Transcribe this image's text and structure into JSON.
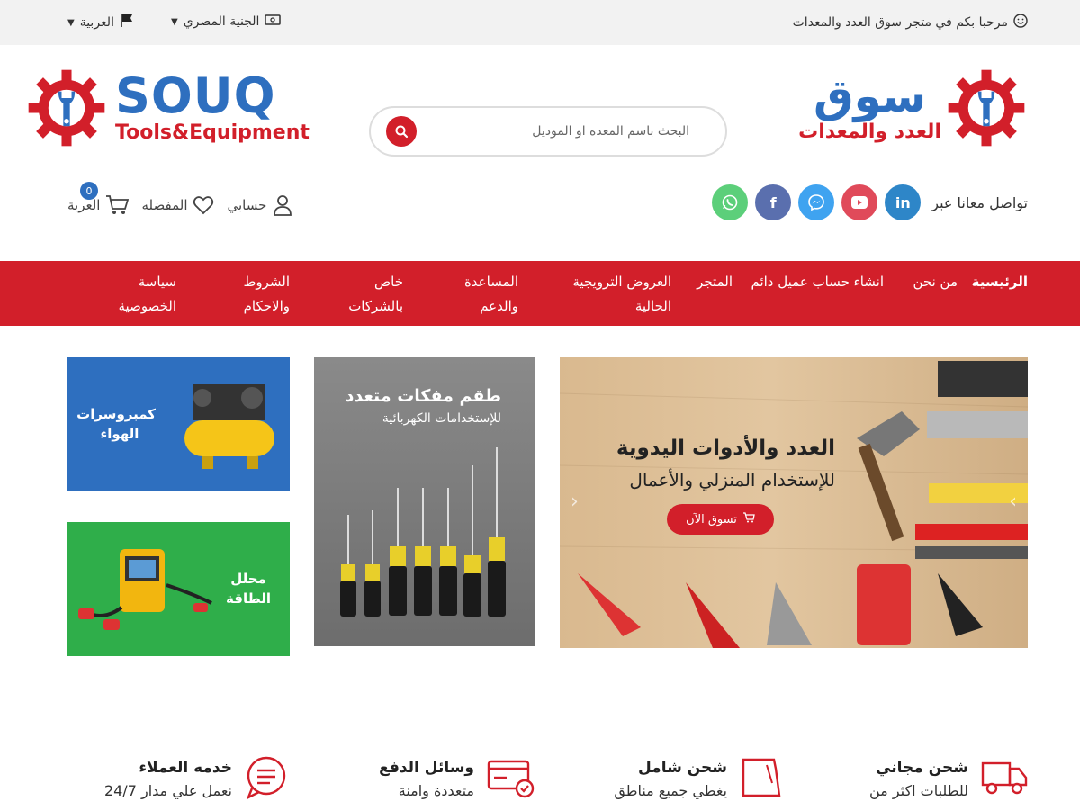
{
  "topbar": {
    "welcome": "مرحبا بكم في متجر سوق العدد والمعدات",
    "currency": "الجنية المصري",
    "language": "العربية"
  },
  "logo": {
    "ar_big": "سوق",
    "ar_small": "العدد والمعدات",
    "en_big": "SOUQ",
    "en_small": "Tools&Equipment"
  },
  "search": {
    "placeholder": "البحث باسم المعده او الموديل"
  },
  "social": {
    "label": "تواصل معانا عبر",
    "items": [
      "linkedin-icon",
      "youtube-icon",
      "messenger-icon",
      "facebook-icon",
      "whatsapp-icon"
    ]
  },
  "account": {
    "account_label": "حسابي",
    "wishlist_label": "المفضله",
    "cart_label": "العربة",
    "cart_count": "0"
  },
  "nav": {
    "items": [
      {
        "label": "الرئيسية",
        "active": true
      },
      {
        "label": "من نحن"
      },
      {
        "label": "انشاء حساب عميل دائم"
      },
      {
        "label": "المتجر"
      },
      {
        "label": "العروض الترويجية الحالية"
      },
      {
        "label": "المساعدة والدعم"
      },
      {
        "label": "خاص بالشركات"
      },
      {
        "label": "الشروط والاحكام"
      },
      {
        "label": "سياسة الخصوصية"
      }
    ]
  },
  "hero": {
    "title": "العدد والأدوات اليدوية",
    "subtitle": "للإستخدام المنزلي والأعمال",
    "cta": "تسوق الآن"
  },
  "promo_middle": {
    "title": "طقم مفكات متعدد",
    "subtitle": "للإستخدامات الكهربائية"
  },
  "promo_top_left": {
    "title": "كمبروسرات الهواء"
  },
  "promo_bottom_left": {
    "title": "محلل الطاقة"
  },
  "features": [
    {
      "title": "شحن مجاني",
      "desc": "للطلبات اكثر من"
    },
    {
      "title": "شحن شامل",
      "desc": "يغطي جميع مناطق"
    },
    {
      "title": "وسائل الدفع",
      "desc": "متعددة وامنة"
    },
    {
      "title": "خدمه العملاء",
      "desc": "نعمل علي مدار 24/7"
    }
  ],
  "colors": {
    "brand_red": "#d21f2a",
    "brand_blue": "#2e6fbf"
  }
}
